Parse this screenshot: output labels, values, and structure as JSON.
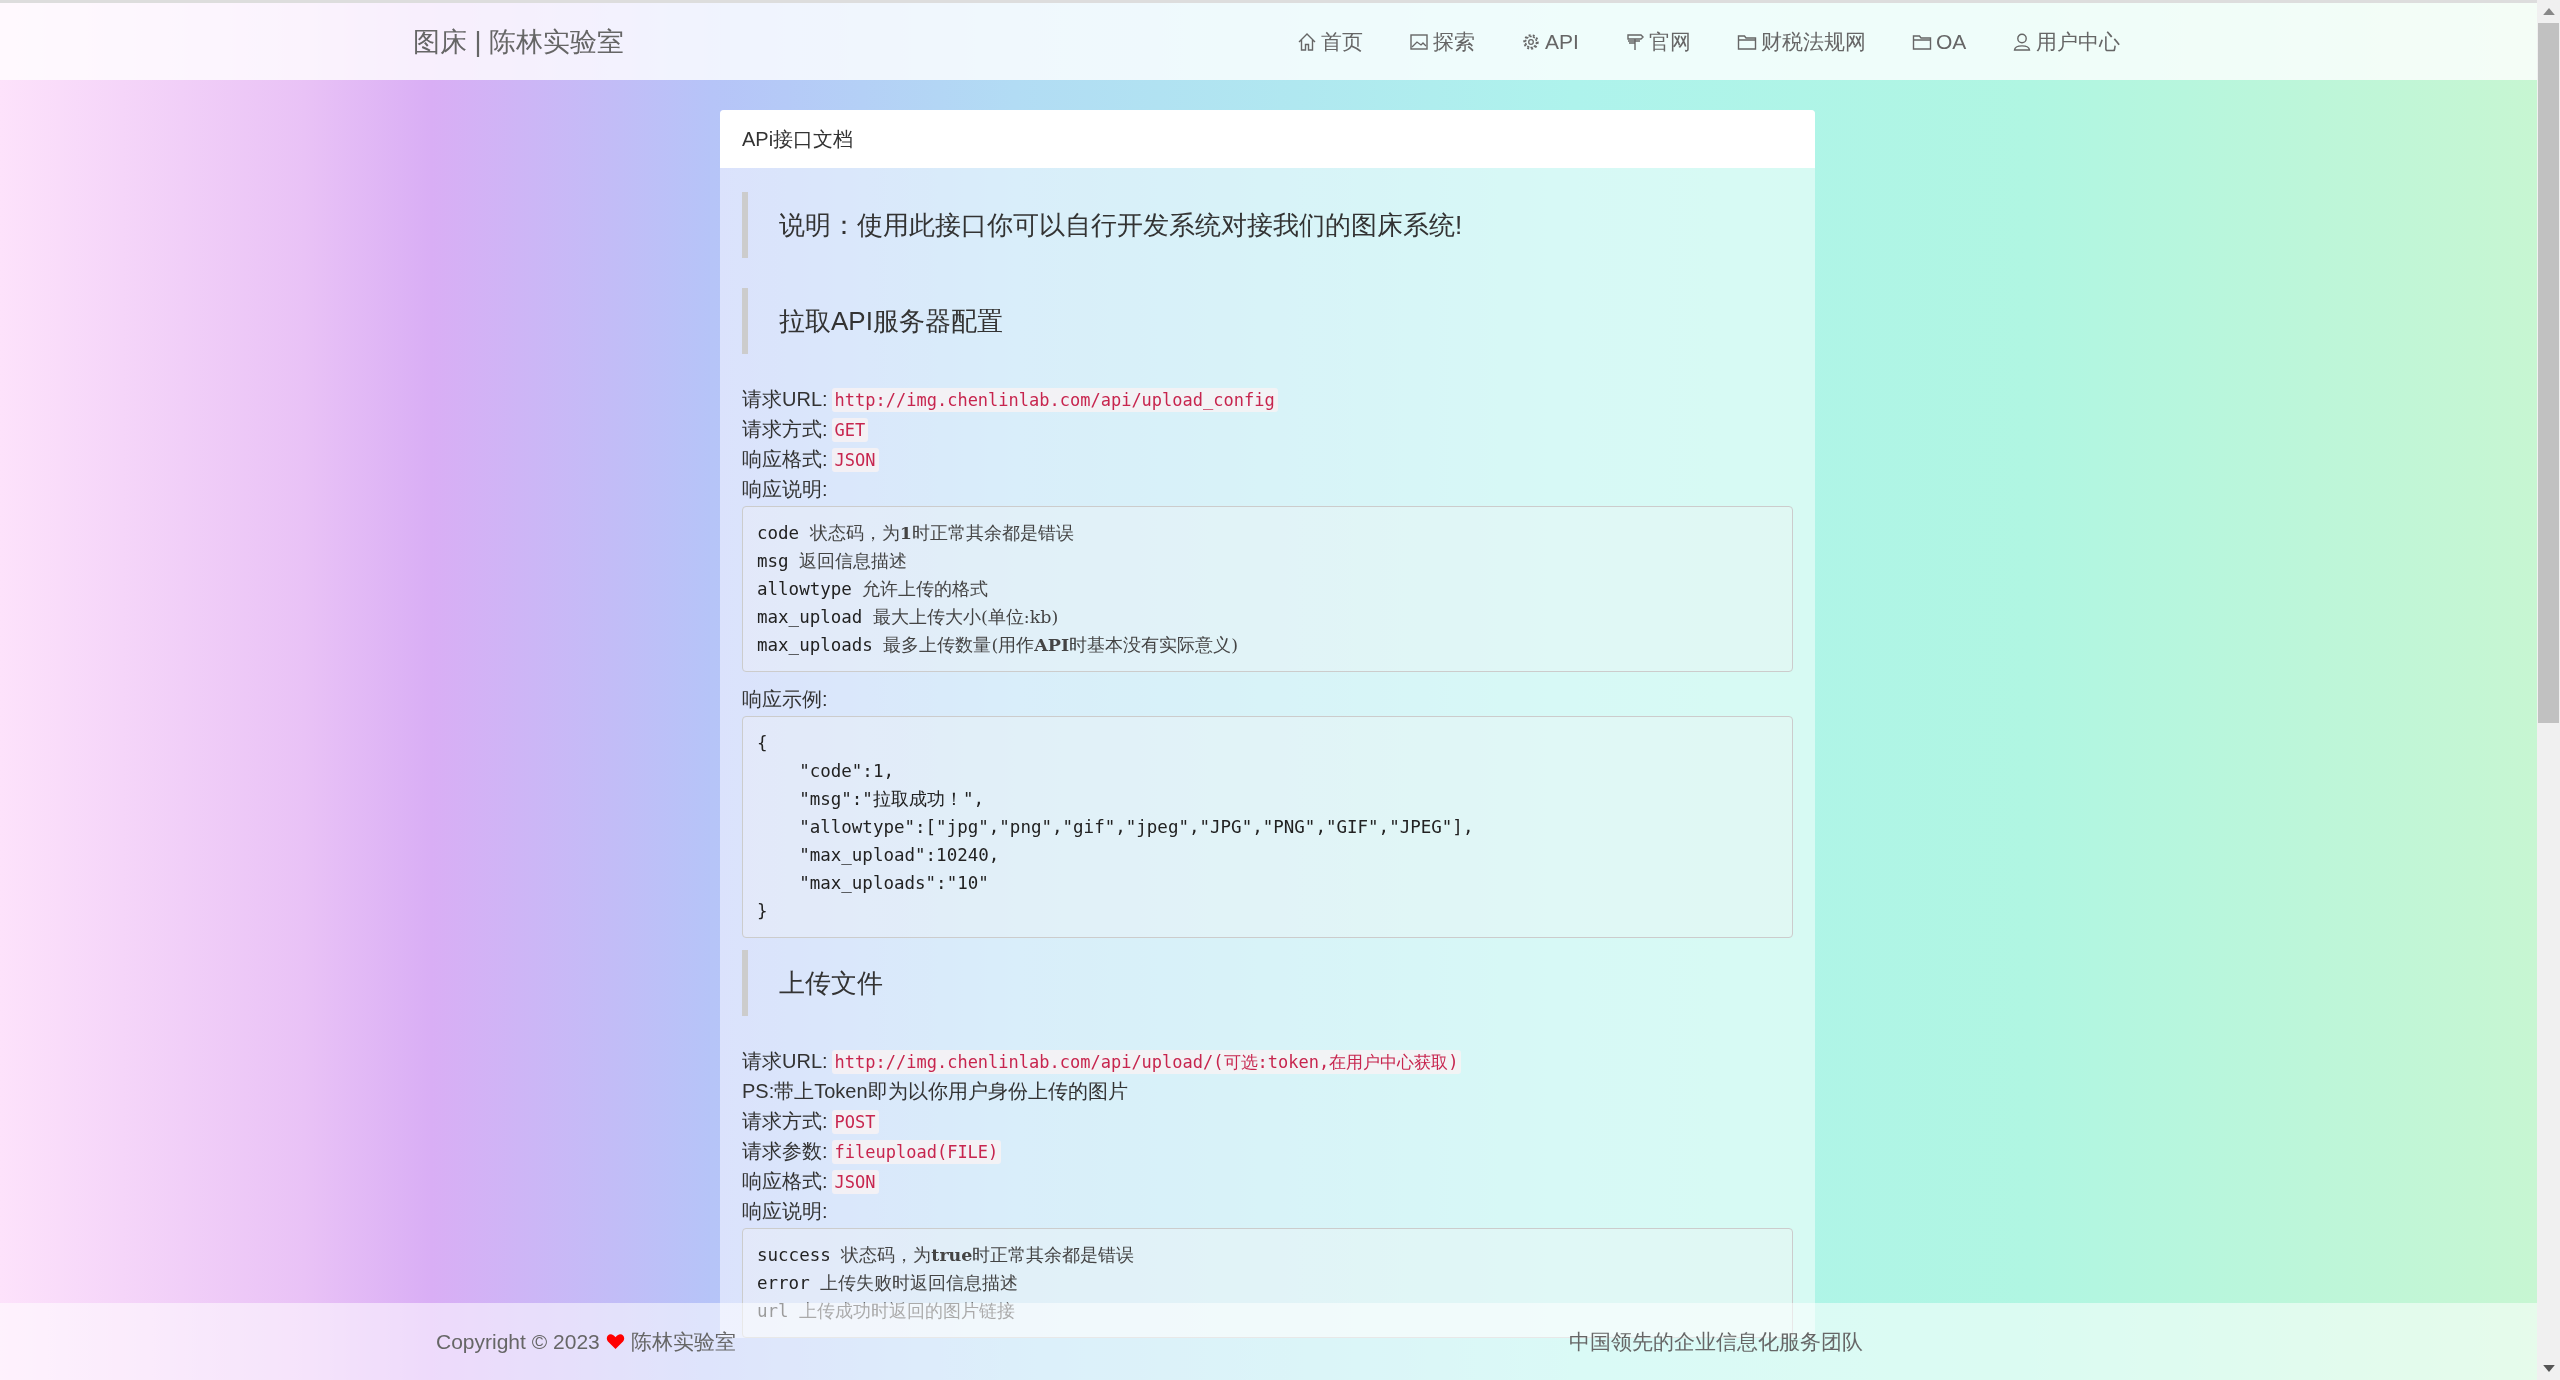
{
  "header": {
    "brand": "图床 | 陈林实验室",
    "nav": [
      {
        "label": "首页"
      },
      {
        "label": "探索"
      },
      {
        "label": "API"
      },
      {
        "label": "官网"
      },
      {
        "label": "财税法规网"
      },
      {
        "label": "OA"
      },
      {
        "label": "用户中心"
      }
    ]
  },
  "card": {
    "title": "APi接口文档",
    "sections": [
      {
        "kind": "note",
        "text": "说明：使用此接口你可以自行开发系统对接我们的图床系统!"
      },
      {
        "kind": "note",
        "text": "拉取API服务器配置"
      },
      {
        "kind": "field",
        "label": "请求URL:",
        "code": "http://img.chenlinlab.com/api/upload_config"
      },
      {
        "kind": "field",
        "label": "请求方式:",
        "code": "GET"
      },
      {
        "kind": "field",
        "label": "响应格式:",
        "code": "JSON"
      },
      {
        "kind": "label",
        "text": "响应说明:"
      },
      {
        "kind": "params",
        "lines": [
          {
            "key": "code",
            "desc": "状态码，为**1**时正常其余都是错误"
          },
          {
            "key": "msg",
            "desc": "返回信息描述"
          },
          {
            "key": "allowtype",
            "desc": "允许上传的格式"
          },
          {
            "key": "max_upload",
            "desc": "最大上传大小(单位:kb)"
          },
          {
            "key": "max_uploads",
            "desc": "最多上传数量(用作**API**时基本没有实际意义)"
          }
        ]
      },
      {
        "kind": "label",
        "text": "响应示例:"
      },
      {
        "kind": "code",
        "lines": [
          "{",
          "    \"code\":1,",
          "    \"msg\":\"拉取成功！\",",
          "    \"allowtype\":[\"jpg\",\"png\",\"gif\",\"jpeg\",\"JPG\",\"PNG\",\"GIF\",\"JPEG\"],",
          "    \"max_upload\":10240,",
          "    \"max_uploads\":\"10\"",
          "}"
        ]
      },
      {
        "kind": "note",
        "text": "上传文件"
      },
      {
        "kind": "field",
        "label": "请求URL:",
        "code": "http://img.chenlinlab.com/api/upload/(可选:token,在用户中心获取)"
      },
      {
        "kind": "label",
        "text": "PS:带上Token即为以你用户身份上传的图片"
      },
      {
        "kind": "field",
        "label": "请求方式:",
        "code": "POST"
      },
      {
        "kind": "field",
        "label": "请求参数:",
        "code": "fileupload(FILE)"
      },
      {
        "kind": "field",
        "label": "响应格式:",
        "code": "JSON"
      },
      {
        "kind": "label",
        "text": "响应说明:"
      },
      {
        "kind": "params",
        "lines": [
          {
            "key": "success",
            "desc": "状态码，为**true**时正常其余都是错误"
          },
          {
            "key": "error",
            "desc": "上传失败时返回信息描述"
          },
          {
            "key": "url",
            "desc": "上传成功时返回的图片链接"
          }
        ]
      }
    ]
  },
  "footer": {
    "copyright": "Copyright © 2023",
    "owner": "陈林实验室",
    "slogan": "中国领先的企业信息化服务团队"
  }
}
